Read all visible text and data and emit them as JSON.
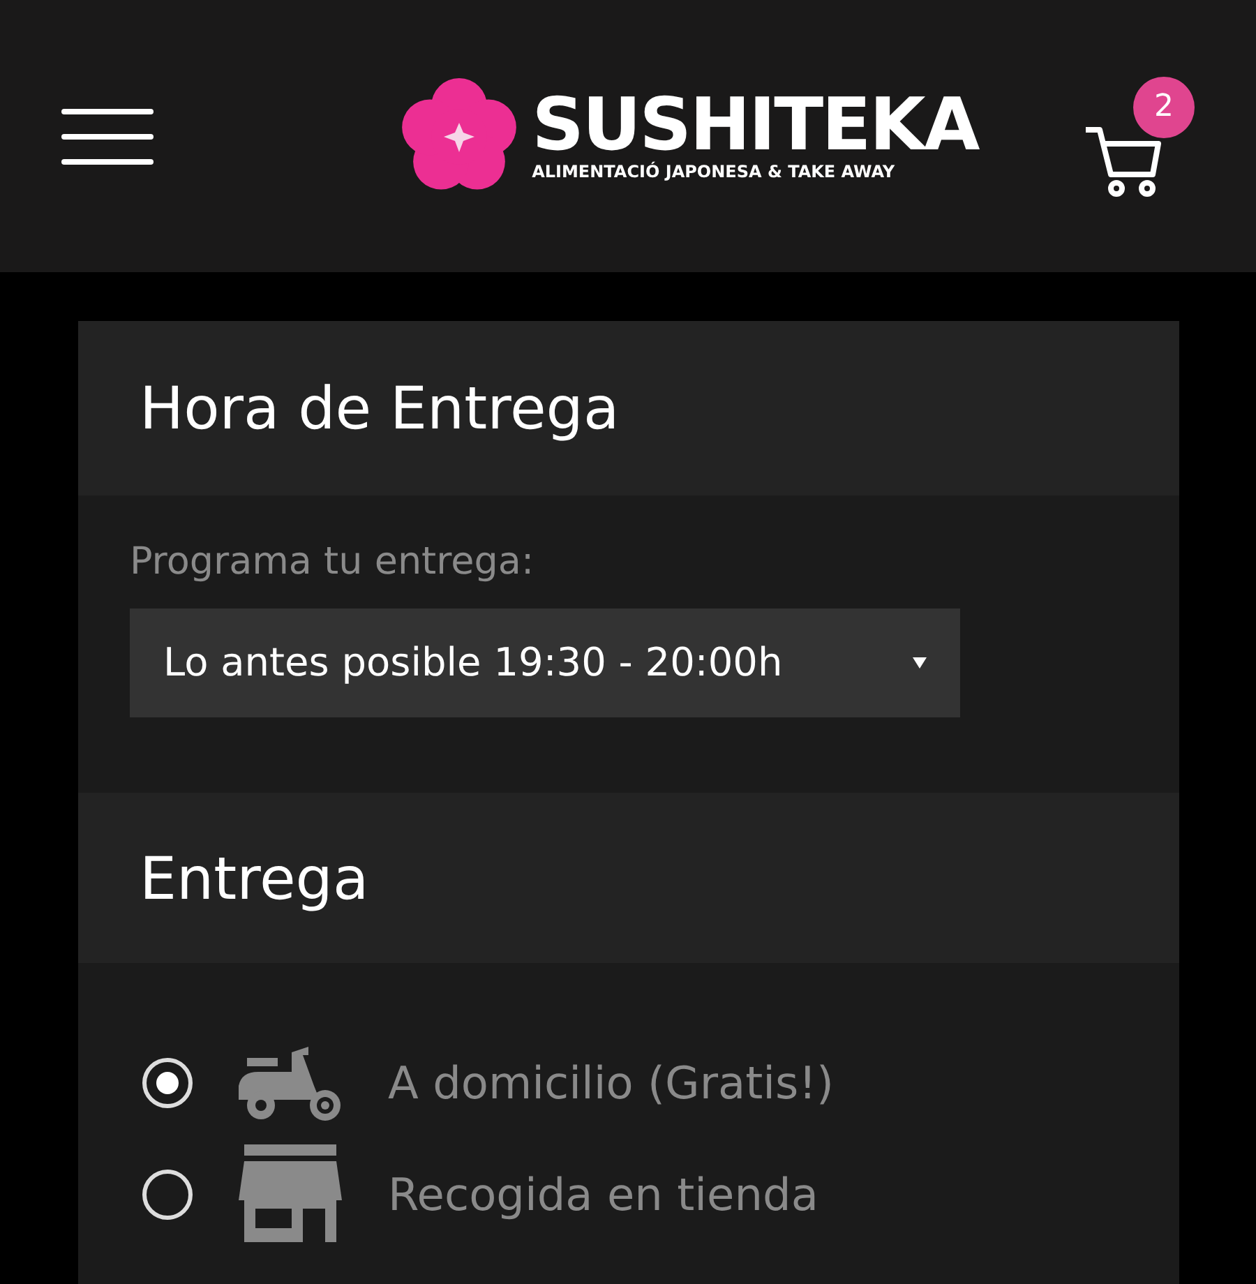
{
  "header": {
    "brand": "SUSHITEKA",
    "tagline": "ALIMENTACIÓ JAPONESA & TAKE AWAY",
    "cart_count": "2"
  },
  "delivery_time": {
    "title": "Hora de Entrega",
    "label": "Programa tu entrega:",
    "select_value": "Lo antes posible 19:30 - 20:00h"
  },
  "delivery": {
    "title": "Entrega",
    "options": [
      {
        "kind": "scooter",
        "label": "A domicilio (Gratis!)",
        "selected": true
      },
      {
        "kind": "store",
        "label": "Recogida en tienda",
        "selected": false
      }
    ]
  }
}
